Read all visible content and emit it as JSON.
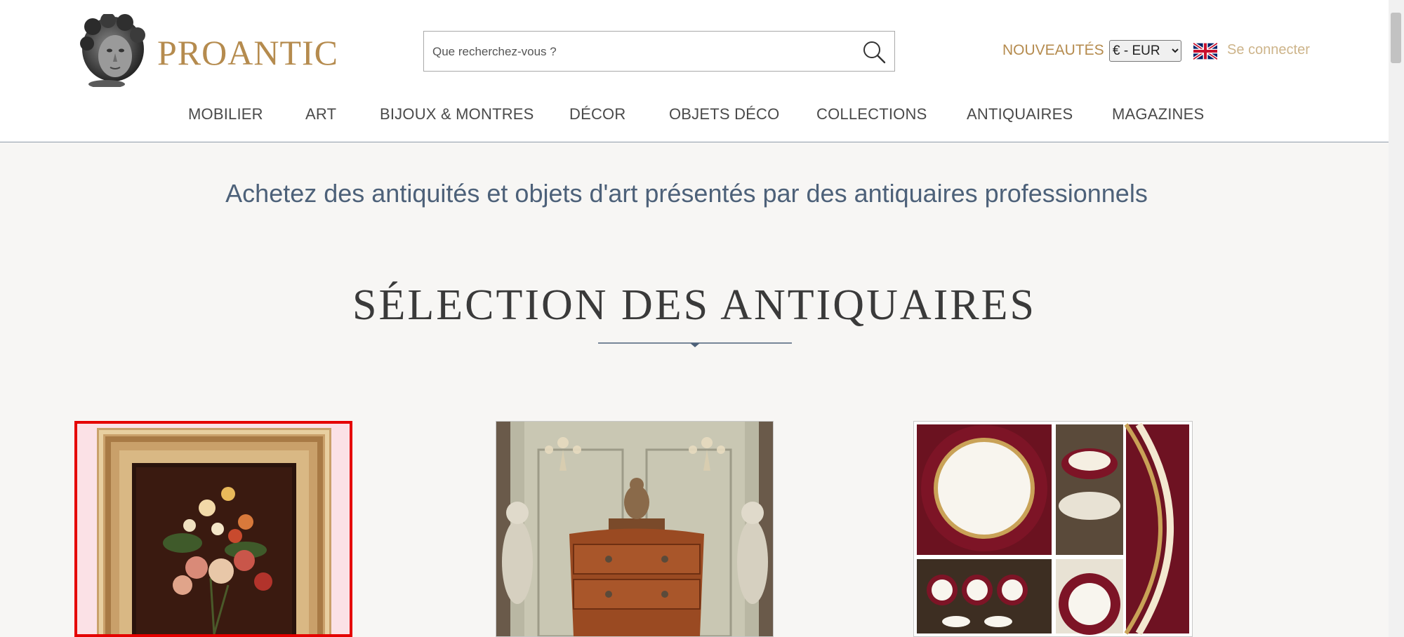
{
  "brand": {
    "name": "PROANTIC"
  },
  "search": {
    "placeholder": "Que recherchez-vous ?"
  },
  "header": {
    "new_link": "NOUVEAUTÉS",
    "currency": {
      "selected": "€ - EUR"
    },
    "language_icon": "uk-flag-icon",
    "login": "Se connecter"
  },
  "nav": {
    "items": [
      {
        "label": "MOBILIER"
      },
      {
        "label": "ART"
      },
      {
        "label": "BIJOUX & MONTRES"
      },
      {
        "label": "DÉCOR"
      },
      {
        "label": "OBJETS DÉCO"
      },
      {
        "label": "COLLECTIONS"
      },
      {
        "label": "ANTIQUAIRES"
      },
      {
        "label": "MAGAZINES"
      }
    ]
  },
  "main": {
    "tagline": "Achetez des antiquités et objets d'art présentés par des antiquaires professionnels",
    "section_title": "SÉLECTION DES ANTIQUAIRES"
  },
  "colors": {
    "brand_gold": "#b58b4e",
    "text_blue_grey": "#4d6179",
    "highlight_red": "#e50000"
  }
}
